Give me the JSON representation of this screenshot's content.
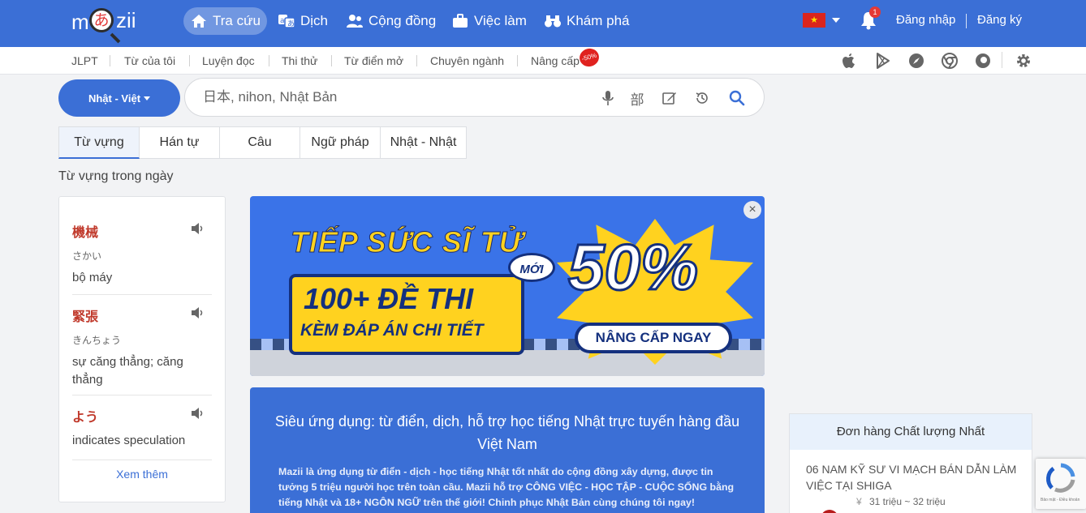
{
  "brand": {
    "logo_left": "m",
    "logo_kana": "あ",
    "logo_right": "zii"
  },
  "nav": {
    "items": [
      {
        "label": "Tra cứu",
        "icon": "home-icon",
        "active": true
      },
      {
        "label": "Dịch",
        "icon": "translate-icon",
        "active": false
      },
      {
        "label": "Cộng đồng",
        "icon": "users-icon",
        "active": false
      },
      {
        "label": "Việc làm",
        "icon": "briefcase-icon",
        "active": false
      },
      {
        "label": "Khám phá",
        "icon": "binoculars-icon",
        "active": false
      }
    ],
    "flag_star": "★",
    "notification_count": "1",
    "login": "Đăng nhập",
    "register": "Đăng ký"
  },
  "subnav": {
    "items": [
      "JLPT",
      "Từ của tôi",
      "Luyện đọc",
      "Thi thử",
      "Từ điển mở",
      "Chuyên ngành",
      "Nâng cấp"
    ],
    "sale_badge": "-50%",
    "app_icons": [
      "apple-icon",
      "google-play-icon",
      "safari-icon",
      "chrome-icon",
      "firefox-icon",
      "settings-icon"
    ]
  },
  "search": {
    "language": "Nhật - Việt",
    "placeholder": "日本, nihon, Nhật Bản",
    "radical_label": "部"
  },
  "tabs": [
    "Từ vựng",
    "Hán tự",
    "Câu",
    "Ngữ pháp",
    "Nhật - Nhật"
  ],
  "daily": {
    "title": "Từ vựng trong ngày",
    "words": [
      {
        "kanji": "機械",
        "kana": "さかい",
        "meaning": "bộ máy"
      },
      {
        "kanji": "緊張",
        "kana": "きんちょう",
        "meaning": "sự căng thẳng; căng thẳng"
      },
      {
        "kanji": "よう",
        "kana": "",
        "meaning": "indicates speculation"
      }
    ],
    "more": "Xem thêm"
  },
  "banner": {
    "title": "TIẾP SỨC SĨ TỬ",
    "line1": "100+ ĐỀ THI",
    "line2": "KÈM ĐÁP ÁN CHI TIẾT",
    "new_tag": "MỚI",
    "discount": "50%",
    "cta": "NÂNG CẤP NGAY",
    "close": "×"
  },
  "info": {
    "title": "Siêu ứng dụng: từ điển, dịch, hỗ trợ học tiếng Nhật trực tuyến hàng đầu Việt Nam",
    "body": "Mazii là ứng dụng từ điển - dịch - học tiếng Nhật tốt nhất do cộng đồng xây dựng, được tin tưởng 5 triệu người học trên toàn cầu. Mazii hỗ trợ CÔNG VIỆC - HỌC TẬP - CUỘC SỐNG bằng tiếng Nhật và 18+ NGÔN NGỮ trên thế giới! Chinh phục Nhật Bản cùng chúng tôi ngay!"
  },
  "jobs": {
    "header": "Đơn hàng Chất lượng Nhất",
    "title": "06 NAM KỸ SƯ VI MẠCH BÁN DẪN LÀM VIỆC TẠI SHIGA",
    "currency": "¥",
    "salary": "31 triệu ~ 32 triệu"
  },
  "captcha": {
    "text": "Bảo mật - Điều khoản"
  },
  "colors": {
    "primary": "#3b6fd6",
    "accent_red": "#c0392b",
    "banner_yellow": "#ffd21f"
  }
}
